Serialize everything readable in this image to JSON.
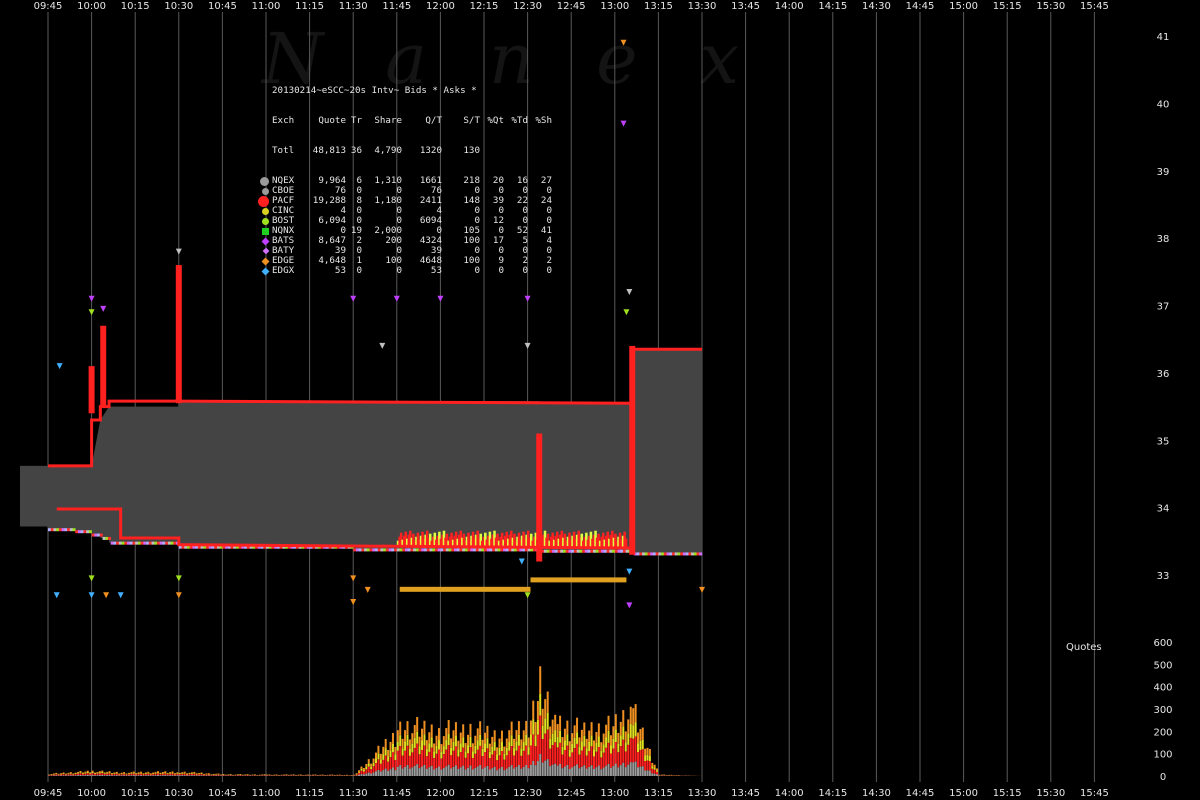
{
  "watermark": "Nanex",
  "header": "20130214~eSCC~20s Intv~ Bids * Asks *",
  "table": {
    "columns": [
      "Exch",
      "Quote",
      "Tr",
      "Share",
      "Q/T",
      "S/T",
      "%Qt",
      "%Td",
      "%Sh"
    ],
    "total": {
      "name": "Totl",
      "quote": "48,813",
      "tr": "36",
      "share": "4,790",
      "qt": "1320",
      "st": "130",
      "xqt": "",
      "xtd": "",
      "xsh": ""
    },
    "rows": [
      {
        "name": "NQEX",
        "quote": "9,964",
        "tr": "6",
        "share": "1,310",
        "qt": "1661",
        "st": "218",
        "xqt": "20",
        "xtd": "16",
        "xsh": "27",
        "color": "#9a9a9a",
        "shape": "circle-lg"
      },
      {
        "name": "CBOE",
        "quote": "76",
        "tr": "0",
        "share": "0",
        "qt": "76",
        "st": "0",
        "xqt": "0",
        "xtd": "0",
        "xsh": "0",
        "color": "#9a9a9a",
        "shape": "circle"
      },
      {
        "name": "PACF",
        "quote": "19,288",
        "tr": "8",
        "share": "1,180",
        "qt": "2411",
        "st": "148",
        "xqt": "39",
        "xtd": "22",
        "xsh": "24",
        "color": "#ff2020",
        "shape": "circle-xl"
      },
      {
        "name": "CINC",
        "quote": "4",
        "tr": "0",
        "share": "0",
        "qt": "4",
        "st": "0",
        "xqt": "0",
        "xtd": "0",
        "xsh": "0",
        "color": "#d8d020",
        "shape": "circle"
      },
      {
        "name": "BOST",
        "quote": "6,094",
        "tr": "0",
        "share": "0",
        "qt": "6094",
        "st": "0",
        "xqt": "12",
        "xtd": "0",
        "xsh": "0",
        "color": "#a0e020",
        "shape": "circle"
      },
      {
        "name": "NQNX",
        "quote": "0",
        "tr": "19",
        "share": "2,000",
        "qt": "0",
        "st": "105",
        "xqt": "0",
        "xtd": "52",
        "xsh": "41",
        "color": "#20d020",
        "shape": "square"
      },
      {
        "name": "BATS",
        "quote": "8,647",
        "tr": "2",
        "share": "200",
        "qt": "4324",
        "st": "100",
        "xqt": "17",
        "xtd": "5",
        "xsh": "4",
        "color": "#c040ff",
        "shape": "diamond"
      },
      {
        "name": "BATY",
        "quote": "39",
        "tr": "0",
        "share": "0",
        "qt": "39",
        "st": "0",
        "xqt": "0",
        "xtd": "0",
        "xsh": "0",
        "color": "#d070ff",
        "shape": "diamond-sm"
      },
      {
        "name": "EDGE",
        "quote": "4,648",
        "tr": "1",
        "share": "100",
        "qt": "4648",
        "st": "100",
        "xqt": "9",
        "xtd": "2",
        "xsh": "2",
        "color": "#f09020",
        "shape": "diamond"
      },
      {
        "name": "EDGX",
        "quote": "53",
        "tr": "0",
        "share": "0",
        "qt": "53",
        "st": "0",
        "xqt": "0",
        "xtd": "0",
        "xsh": "0",
        "color": "#40b0ff",
        "shape": "diamond"
      }
    ]
  },
  "quotes_label": "Quotes",
  "chart_data": {
    "type": "area",
    "title": "",
    "x_ticks": [
      "09:45",
      "10:00",
      "10:15",
      "10:30",
      "10:45",
      "11:00",
      "11:15",
      "11:30",
      "11:45",
      "12:00",
      "12:15",
      "12:30",
      "12:45",
      "13:00",
      "13:15",
      "13:30",
      "13:45",
      "14:00",
      "14:15",
      "14:30",
      "14:45",
      "15:00",
      "15:15",
      "15:30",
      "15:45"
    ],
    "price_ticks": [
      41,
      40,
      39,
      38,
      37,
      36,
      35,
      34,
      33
    ],
    "price_range": [
      32.4,
      41.4
    ],
    "volume_ticks": [
      600,
      500,
      400,
      300,
      200,
      100,
      0
    ],
    "volume_range": [
      0,
      600
    ],
    "spread": {
      "time": [
        "09:45",
        "09:54",
        "09:54",
        "10:00",
        "10:00",
        "10:03",
        "10:03",
        "10:06",
        "10:06",
        "10:30",
        "10:30",
        "11:30",
        "11:30",
        "12:34",
        "12:34",
        "13:06",
        "13:06",
        "13:30"
      ],
      "ask": [
        34.62,
        34.62,
        34.62,
        34.62,
        34.62,
        35.3,
        35.3,
        35.5,
        35.5,
        35.5,
        35.58,
        35.58,
        35.58,
        35.58,
        35.55,
        35.55,
        36.35,
        36.35
      ],
      "bid": [
        33.68,
        33.68,
        33.65,
        33.65,
        33.6,
        33.6,
        33.55,
        33.55,
        33.48,
        33.48,
        33.42,
        33.42,
        33.38,
        33.38,
        33.36,
        33.36,
        33.32,
        33.32
      ]
    },
    "nbbo_series": [
      {
        "name": "PACF ask",
        "color": "#ff2020",
        "time": [
          "09:45",
          "10:00",
          "10:00",
          "10:03",
          "10:03",
          "10:06",
          "10:06",
          "10:30",
          "10:30",
          "13:06",
          "13:06",
          "13:30"
        ],
        "price": [
          34.62,
          34.62,
          35.3,
          35.3,
          35.5,
          35.5,
          35.58,
          35.58,
          35.58,
          35.55,
          36.35,
          36.35
        ]
      },
      {
        "name": "PACF bid",
        "color": "#ff2020",
        "time": [
          "09:48",
          "10:10",
          "10:10",
          "10:30",
          "10:30",
          "13:06"
        ],
        "price": [
          33.98,
          33.98,
          33.55,
          33.55,
          33.45,
          33.4
        ]
      }
    ],
    "spikes": [
      {
        "time": "10:00",
        "low": 35.4,
        "high": 36.1,
        "color": "#ff2020"
      },
      {
        "time": "10:04",
        "low": 35.5,
        "high": 36.7,
        "color": "#ff2020"
      },
      {
        "time": "10:30",
        "low": 35.55,
        "high": 37.6,
        "color": "#ff2020"
      },
      {
        "time": "12:34",
        "low": 33.2,
        "high": 35.1,
        "color": "#ff2020"
      },
      {
        "time": "13:06",
        "low": 33.3,
        "high": 36.4,
        "color": "#ff2020"
      }
    ],
    "edge_levels": [
      {
        "time_start": "11:46",
        "time_end": "12:31",
        "price": 32.78
      },
      {
        "time_start": "12:31",
        "time_end": "13:04",
        "price": 32.92
      }
    ],
    "volume": {
      "time": [
        "09:45",
        "10:00",
        "10:10",
        "10:30",
        "10:45",
        "11:00",
        "11:15",
        "11:30",
        "11:45",
        "11:50",
        "12:00",
        "12:10",
        "12:20",
        "12:30",
        "12:34",
        "12:40",
        "12:50",
        "13:00",
        "13:06",
        "13:15",
        "13:30"
      ],
      "total": [
        12,
        28,
        20,
        24,
        10,
        8,
        8,
        6,
        250,
        280,
        260,
        270,
        230,
        290,
        540,
        300,
        260,
        290,
        370,
        8,
        0
      ]
    }
  }
}
